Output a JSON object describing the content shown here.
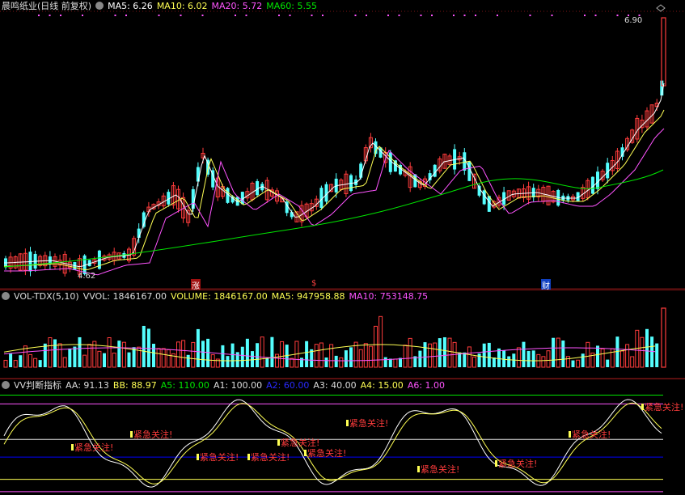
{
  "price_header": {
    "title": "晨鸣纸业(日线 前复权)",
    "ma5": "MA5: 6.26",
    "ma10": "MA10: 6.02",
    "ma20": "MA20: 5.72",
    "ma60": "MA60: 5.55"
  },
  "price_annotations": {
    "high": "6.90",
    "low": "4.62",
    "marker_zhang": "涨",
    "marker_s": "$",
    "marker_cai": "财"
  },
  "vol_header": {
    "name": "VOL-TDX(5,10)",
    "vvol": "VVOL: 1846167.00",
    "volume": "VOLUME: 1846167.00",
    "ma5": "MA5: 947958.88",
    "ma10": "MA10: 753148.75"
  },
  "ind_header": {
    "name": "VV判断指标",
    "aa": "AA: 91.13",
    "bb": "BB: 88.97",
    "a5": "A5: 110.00",
    "a1": "A1: 100.00",
    "a2": "A2: 60.00",
    "a3": "A3: 40.00",
    "a4": "A4: 15.00",
    "a6": "A6: 1.00"
  },
  "alert_text": "紧急关注!",
  "colors": {
    "up": "#ff3c3c",
    "down": "#54ffff",
    "ma5": "#ffffff",
    "ma10": "#ffff54",
    "ma20": "#ff54ff",
    "ma60": "#00e600",
    "grid_red": "#7a1414",
    "a2_blue": "#0000ff"
  },
  "chart_data": [
    {
      "type": "candlestick",
      "title": "晨鸣纸业(日线 前复权)",
      "series_legend": [
        "MA5: 6.26",
        "MA10: 6.02",
        "MA20: 5.72",
        "MA60: 5.55"
      ],
      "ylim": [
        4.55,
        6.95
      ],
      "annotations": [
        "6.90",
        "4.62"
      ]
    },
    {
      "type": "bar",
      "title": "VOL-TDX(5,10)",
      "series_legend": [
        "VVOL: 1846167.00",
        "VOLUME: 1846167.00",
        "MA5: 947958.88",
        "MA10: 753148.75"
      ]
    },
    {
      "type": "line",
      "title": "VV判断指标",
      "reference_lines": {
        "A5": 110,
        "A1": 100,
        "A2": 60,
        "A3": 40,
        "A4": 15,
        "A6": 1
      },
      "series_legend": [
        "AA: 91.13",
        "BB: 88.97"
      ],
      "ylim": [
        0,
        115
      ]
    }
  ]
}
